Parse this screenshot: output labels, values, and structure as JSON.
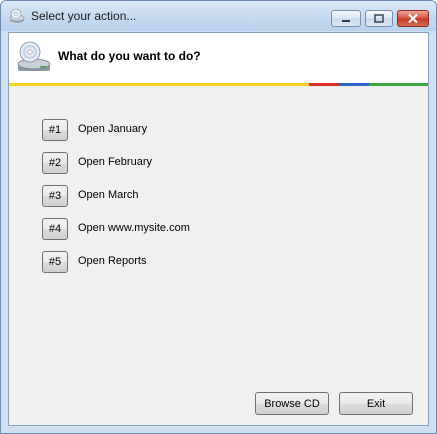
{
  "window": {
    "title": "Select your action...",
    "icon": "cd-drive-icon"
  },
  "header": {
    "title": "What do you want to do?",
    "icon": "cd-drive-icon",
    "stripe_colors": [
      "#f4d21f",
      "#d9312a",
      "#2d63c7",
      "#3aa63d"
    ]
  },
  "actions": [
    {
      "number": "#1",
      "label": "Open January"
    },
    {
      "number": "#2",
      "label": "Open February"
    },
    {
      "number": "#3",
      "label": "Open March"
    },
    {
      "number": "#4",
      "label": "Open www.mysite.com"
    },
    {
      "number": "#5",
      "label": "Open Reports"
    }
  ],
  "buttons": {
    "browse_label": "Browse CD",
    "exit_label": "Exit"
  }
}
